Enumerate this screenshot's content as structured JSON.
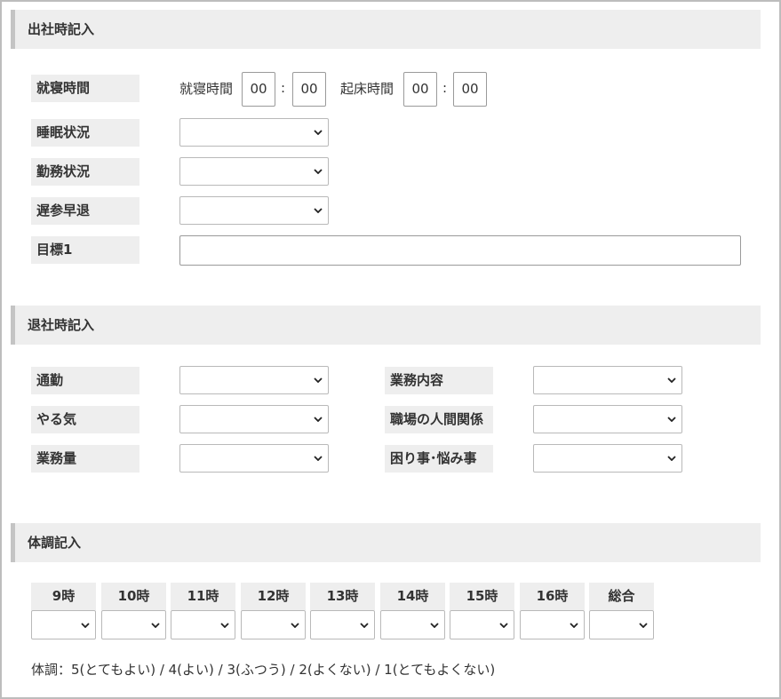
{
  "sections": {
    "attendance": {
      "title": "出社時記入"
    },
    "leave": {
      "title": "退社時記入"
    },
    "health": {
      "title": "体調記入"
    }
  },
  "attendance": {
    "bedtime_label": "就寝時間",
    "bedtime_inline_label": "就寝時間",
    "bedtime_hour": "00",
    "bedtime_minute": "00",
    "colon": ":",
    "wake_label": "起床時間",
    "wake_hour": "00",
    "wake_minute": "00",
    "sleep_status_label": "睡眠状況",
    "work_status_label": "勤務状況",
    "late_early_label": "遅参早退",
    "goal_label": "目標1",
    "goal_value": ""
  },
  "leave": {
    "commute_label": "通勤",
    "motivation_label": "やる気",
    "workload_label": "業務量",
    "work_content_label": "業務内容",
    "relations_label": "職場の人間関係",
    "troubles_label": "困り事･悩み事"
  },
  "health": {
    "hours": [
      "9時",
      "10時",
      "11時",
      "12時",
      "13時",
      "14時",
      "15時",
      "16時",
      "総合"
    ],
    "legend": "体調：5(とてもよい) / 4(よい) / 3(ふつう) / 2(よくない) / 1(とてもよくない)"
  }
}
